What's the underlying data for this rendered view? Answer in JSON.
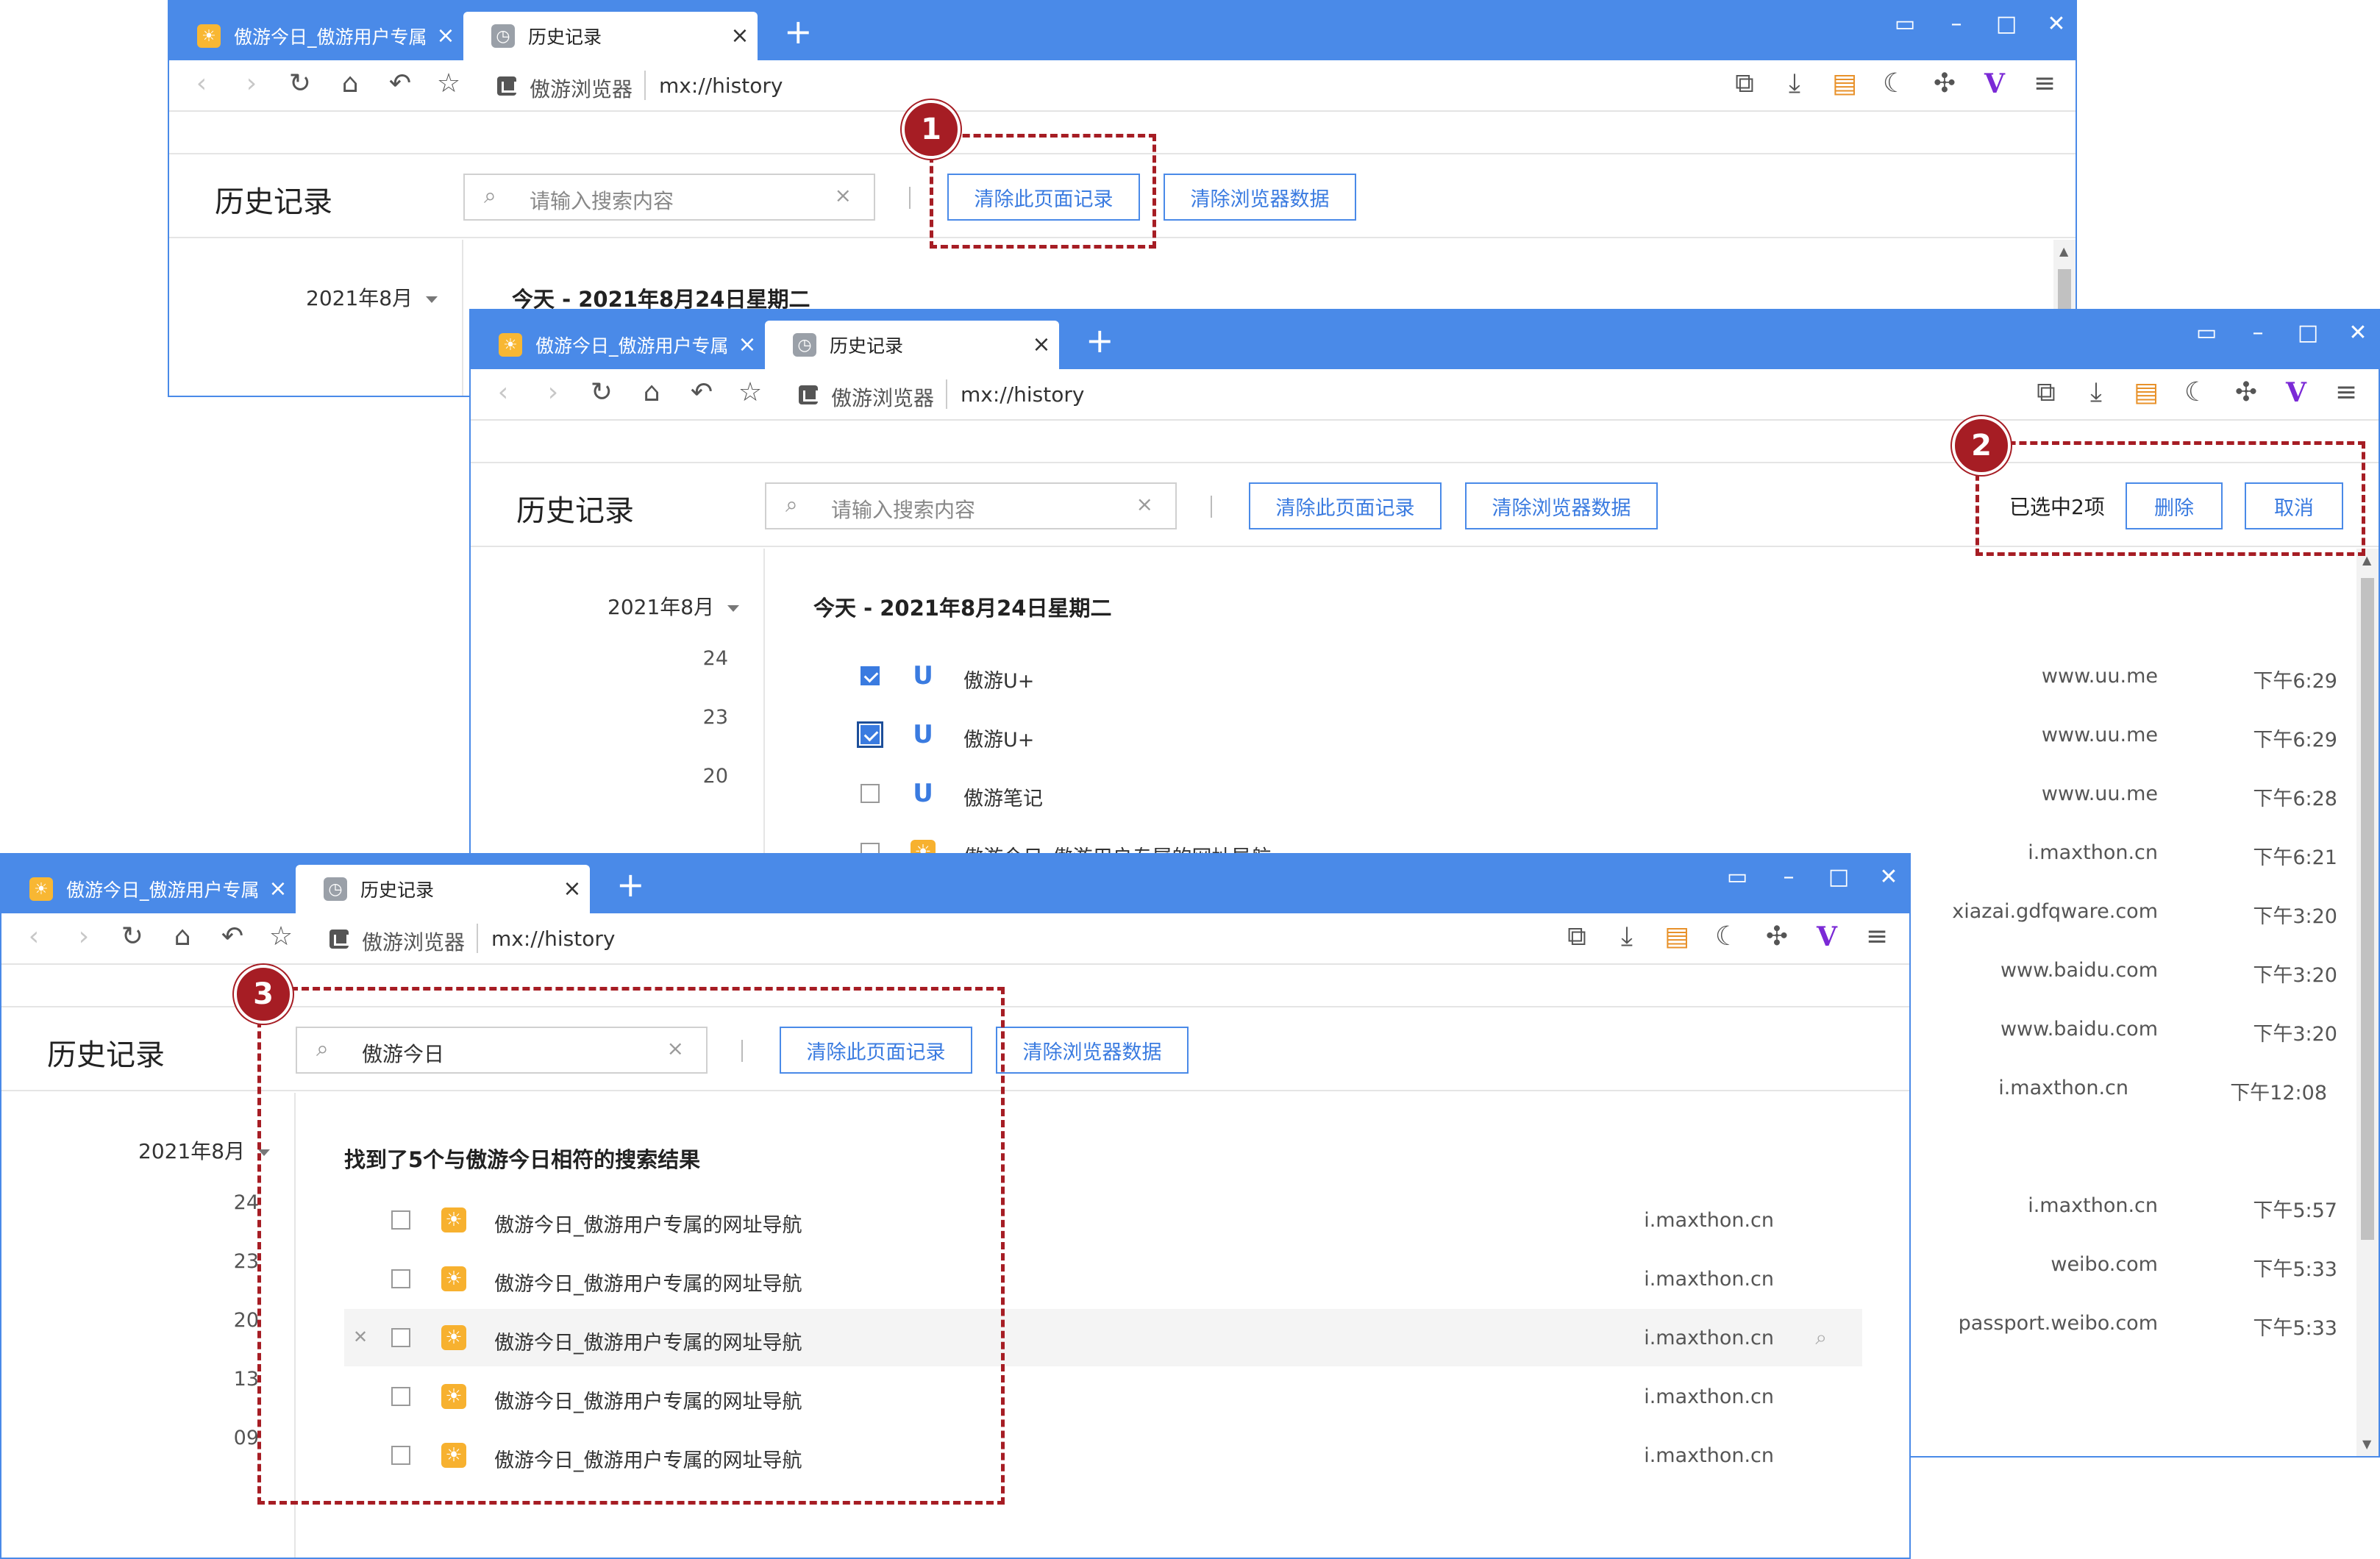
{
  "browser": {
    "tab_inactive": "傲游今日_傲游用户专属",
    "tab_active": "历史记录",
    "site_name": "傲游浏览器",
    "url": "mx://history",
    "new_tab": "+",
    "close_glyph": "×"
  },
  "history": {
    "page_title": "历史记录",
    "search_placeholder": "请输入搜索内容",
    "clear_page_label": "清除此页面记录",
    "clear_browser_label": "清除浏览器数据",
    "month": "2021年8月",
    "days": [
      "24",
      "23",
      "20",
      "13",
      "09"
    ]
  },
  "window1": {
    "day_header": "今天 - 2021年8月24日星期二"
  },
  "window2": {
    "day_header": "今天 - 2021年8月24日星期二",
    "selected_info": "已选中2项",
    "delete_label": "删除",
    "cancel_label": "取消",
    "rows": [
      {
        "title": "傲游U+",
        "url": "www.uu.me",
        "time": "下午6:29",
        "checked": true,
        "icon": "uu-icon"
      },
      {
        "title": "傲游U+",
        "url": "www.uu.me",
        "time": "下午6:29",
        "checked": true,
        "icon": "uu-icon"
      },
      {
        "title": "傲游笔记",
        "url": "www.uu.me",
        "time": "下午6:28",
        "checked": false,
        "icon": "uu-icon"
      },
      {
        "title": "傲游今日_傲游用户专属的网址导航",
        "url": "i.maxthon.cn",
        "time": "下午6:21",
        "checked": false,
        "icon": "maxthon-sun-icon"
      },
      {
        "title": "",
        "url": "xiazai.gdfqware.com",
        "time": "下午3:20",
        "checked": false,
        "icon": ""
      },
      {
        "title": "",
        "url": "www.baidu.com",
        "time": "下午3:20",
        "checked": false,
        "icon": ""
      },
      {
        "title": "",
        "url": "www.baidu.com",
        "time": "下午3:20",
        "checked": false,
        "icon": ""
      },
      {
        "title": "",
        "url": "i.maxthon.cn",
        "time": "下午12:08",
        "checked": false,
        "icon": ""
      },
      {
        "title": "",
        "url": "i.maxthon.cn",
        "time": "下午5:57",
        "checked": false,
        "icon": ""
      },
      {
        "title": "",
        "url": "weibo.com",
        "time": "下午5:33",
        "checked": false,
        "icon": ""
      },
      {
        "title": "",
        "url": "passport.weibo.com",
        "time": "下午5:33",
        "checked": false,
        "icon": ""
      }
    ]
  },
  "window3": {
    "search_value": "傲游今日",
    "results_header": "找到了5个与傲游今日相符的搜索结果",
    "rows": [
      {
        "title": "傲游今日_傲游用户专属的网址导航",
        "url": "i.maxthon.cn"
      },
      {
        "title": "傲游今日_傲游用户专属的网址导航",
        "url": "i.maxthon.cn"
      },
      {
        "title": "傲游今日_傲游用户专属的网址导航",
        "url": "i.maxthon.cn"
      },
      {
        "title": "傲游今日_傲游用户专属的网址导航",
        "url": "i.maxthon.cn"
      },
      {
        "title": "傲游今日_傲游用户专属的网址导航",
        "url": "i.maxthon.cn"
      }
    ]
  },
  "annotations": {
    "badge1": "1",
    "badge2": "2",
    "badge3": "3",
    "color": "#a61d24"
  },
  "colors": {
    "tabbar": "#4a8ae8",
    "accent": "#3a7be0",
    "checkbox_checked": "#3a7be0",
    "sun_icon": "#f7b12f"
  }
}
